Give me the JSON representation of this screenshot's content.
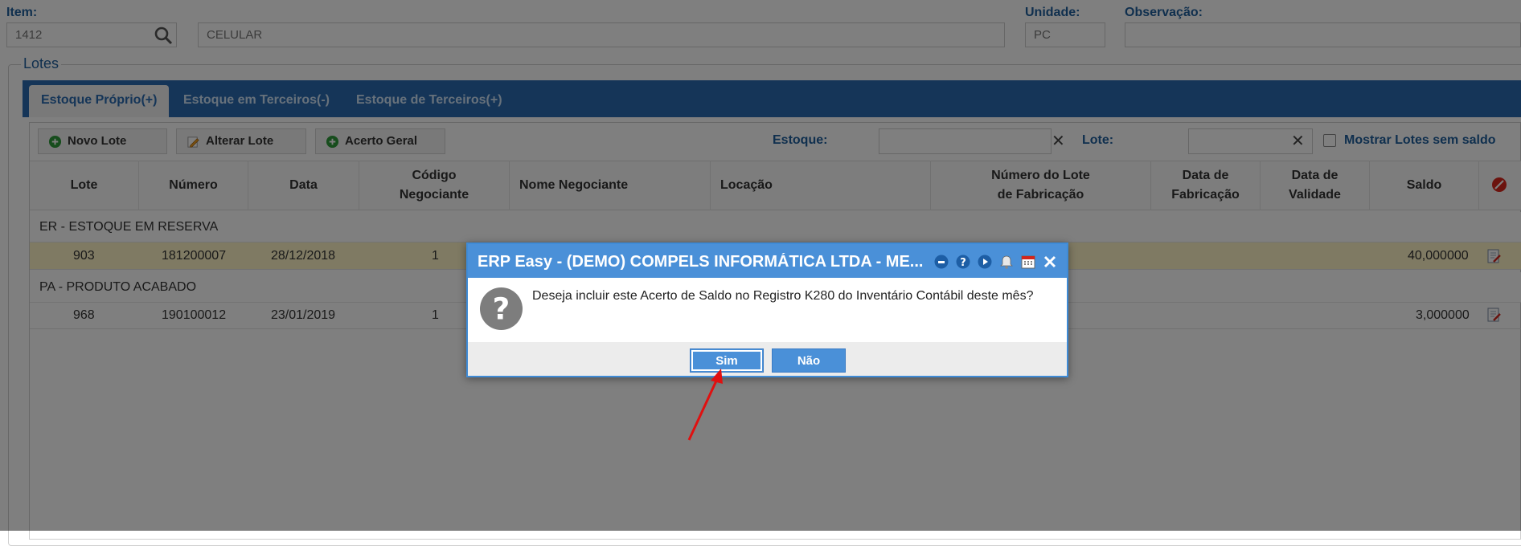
{
  "header": {
    "item_label": "Item:",
    "item_value": "1412",
    "item_description": "CELULAR",
    "unidade_label": "Unidade:",
    "unidade_value": "PC",
    "observacao_label": "Observação:",
    "observacao_value": ""
  },
  "lotes": {
    "legend": "Lotes",
    "tabs": [
      {
        "label": "Estoque Próprio(+)",
        "active": true
      },
      {
        "label": "Estoque em Terceiros(-)",
        "active": false
      },
      {
        "label": "Estoque de Terceiros(+)",
        "active": false
      }
    ],
    "toolbar": {
      "novo_lote": "Novo Lote",
      "alterar_lote": "Alterar Lote",
      "acerto_geral": "Acerto Geral",
      "estoque_label": "Estoque:",
      "lote_label": "Lote:",
      "mostrar_label": "Mostrar Lotes sem saldo"
    },
    "columns": {
      "lote": "Lote",
      "numero": "Número",
      "data": "Data",
      "codigo_negociante_1": "Código",
      "codigo_negociante_2": "Negociante",
      "nome_negociante": "Nome Negociante",
      "locacao": "Locação",
      "num_lote_fab_1": "Número do Lote",
      "num_lote_fab_2": "de Fabricação",
      "data_fab_1": "Data de",
      "data_fab_2": "Fabricação",
      "data_val_1": "Data de",
      "data_val_2": "Validade",
      "saldo": "Saldo"
    },
    "groups": [
      {
        "title": "ER - ESTOQUE EM RESERVA",
        "row": {
          "lote": "903",
          "numero": "181200007",
          "data": "28/12/2018",
          "codigo": "1",
          "saldo": "40,000000"
        }
      },
      {
        "title": "PA - PRODUTO ACABADO",
        "row": {
          "lote": "968",
          "numero": "190100012",
          "data": "23/01/2019",
          "codigo": "1",
          "saldo": "3,000000"
        }
      }
    ]
  },
  "dialog": {
    "title": "ERP Easy - (DEMO) COMPELS INFORMÁTICA LTDA - ME...",
    "message": "Deseja incluir este Acerto de Saldo no Registro K280 do Inventário Contábil deste mês?",
    "yes_label": "Sim",
    "no_label": "Não"
  },
  "colors": {
    "accent": "#2a6bb0",
    "dialog_title": "#4a90d8",
    "selected_row": "#fff5c7",
    "arrow": "#e01010"
  }
}
